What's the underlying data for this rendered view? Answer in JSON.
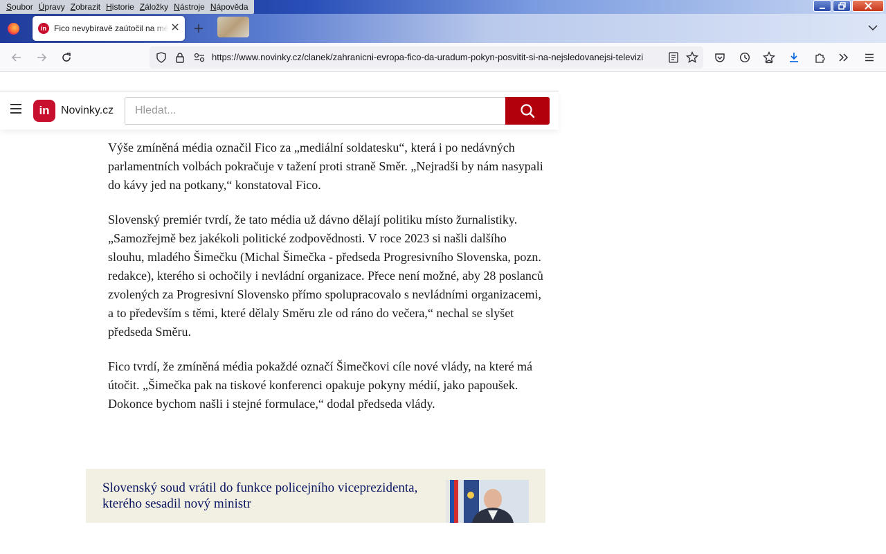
{
  "menu": {
    "items": [
      {
        "accel": "S",
        "rest": "oubor"
      },
      {
        "accel": "Ú",
        "rest": "pravy"
      },
      {
        "accel": "Z",
        "rest": "obrazit"
      },
      {
        "accel": "H",
        "rest": "istorie"
      },
      {
        "accel": "Z",
        "rest": "áložky"
      },
      {
        "accel": "N",
        "rest": "ástroje"
      },
      {
        "accel": "N",
        "rest": "ápověda"
      }
    ]
  },
  "tab": {
    "title": "Fico nevybíravě zaútočil na média",
    "favicon_text": "in"
  },
  "urlbar": {
    "url": "https://www.novinky.cz/clanek/zahranicni-evropa-fico-da-uradum-pokyn-posvitit-si-na-nejsledovanejsi-televizi"
  },
  "site": {
    "logo_text": "in",
    "name": "Novinky.cz",
    "search_placeholder": "Hledat...",
    "brand_color": "#c8102e",
    "search_button_color": "#b3000d"
  },
  "article": {
    "paragraphs": [
      "Výše zmíněná média označil Fico za „mediální soldatesku“, která i po nedávných parlamentních volbách pokračuje v tažení proti straně Směr. „Nejradši by nám nasypali do kávy jed na potkany,“ konstatoval Fico.",
      "Slovenský premiér tvrdí, že tato média už dávno dělají politiku místo žurnalistiky. „Samozřejmě bez jakékoli politické zodpovědnosti. V roce 2023 si našli dalšího slouhu, mladého Šimečku (Michal Šimečka - předseda Progresivního Slovenska, pozn. redakce), kterého si ochočily i nevládní organizace. Přece není možné, aby 28 poslanců zvolených za Progresivní Slovensko přímo spolupracovalo s nevládními organizacemi, a to především s těmi, které dělaly Směru zle od ráno do večera,“ nechal se slyšet předseda Směru.",
      "Fico tvrdí, že zmíněná média pokaždé označí Šimečkovi cíle nové vlády, na které má útočit. „Šimečka pak na tiskové konferenci opakuje pokyny médií, jako papoušek. Dokonce bychom našli i stejné formulace,“ dodal předseda vlády."
    ]
  },
  "related": {
    "title": "Slovenský soud vrátil do funkce policejního viceprezidenta, kterého sesadil nový ministr"
  }
}
